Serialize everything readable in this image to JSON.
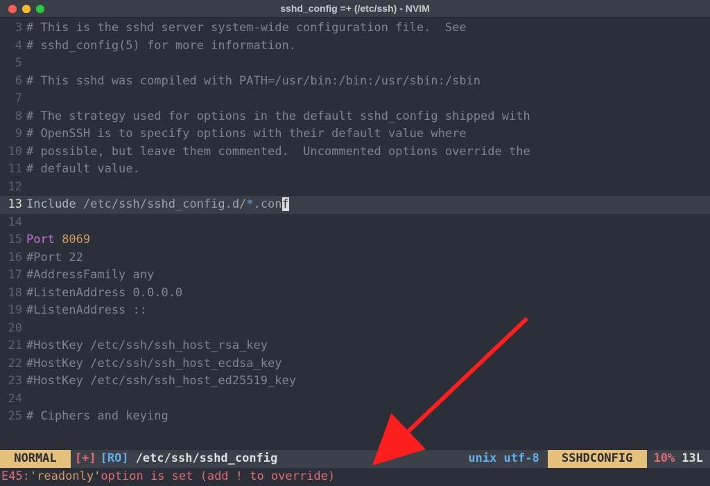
{
  "window": {
    "title": "sshd_config =+ (/etc/ssh) - NVIM"
  },
  "cursor_line_number": "13",
  "lines": {
    "l3": {
      "num": "3",
      "text": "# This is the sshd server system-wide configuration file.  See"
    },
    "l4": {
      "num": "4",
      "text": "# sshd_config(5) for more information."
    },
    "l5": {
      "num": "5",
      "text": ""
    },
    "l6": {
      "num": "6",
      "text": "# This sshd was compiled with PATH=/usr/bin:/bin:/usr/sbin:/sbin"
    },
    "l7": {
      "num": "7",
      "text": ""
    },
    "l8": {
      "num": "8",
      "text": "# The strategy used for options in the default sshd_config shipped with"
    },
    "l9": {
      "num": "9",
      "text": "# OpenSSH is to specify options with their default value where"
    },
    "l10": {
      "num": "10",
      "text": "# possible, but leave them commented.  Uncommented options override the"
    },
    "l11": {
      "num": "11",
      "text": "# default value."
    },
    "l12": {
      "num": "12",
      "text": ""
    },
    "l13": {
      "num": "13",
      "include": "Include ",
      "path": "/etc/ssh/sshd_config.d/",
      "glob": "*",
      "ext": ".con",
      "cursor": "f"
    },
    "l14": {
      "num": "14",
      "text": ""
    },
    "l15": {
      "num": "15",
      "kw": "Port ",
      "val": "8069"
    },
    "l16": {
      "num": "16",
      "text": "#Port 22"
    },
    "l17": {
      "num": "17",
      "text": "#AddressFamily any"
    },
    "l18": {
      "num": "18",
      "text": "#ListenAddress 0.0.0.0"
    },
    "l19": {
      "num": "19",
      "text": "#ListenAddress ::"
    },
    "l20": {
      "num": "20",
      "text": ""
    },
    "l21": {
      "num": "21",
      "text": "#HostKey /etc/ssh/ssh_host_rsa_key"
    },
    "l22": {
      "num": "22",
      "text": "#HostKey /etc/ssh/ssh_host_ecdsa_key"
    },
    "l23": {
      "num": "23",
      "text": "#HostKey /etc/ssh/ssh_host_ed25519_key"
    },
    "l24": {
      "num": "24",
      "text": ""
    },
    "l25": {
      "num": "25",
      "text": "# Ciphers and keying"
    }
  },
  "status": {
    "mode": " NORMAL ",
    "modified": "[+]",
    "readonly": "[RO]",
    "file": "/etc/ssh/sshd_config",
    "encoding": "unix utf-8",
    "filetype": " SSHDCONFIG ",
    "percent": "10%",
    "lines": "13L"
  },
  "cmdline": {
    "prefix": "E45: ",
    "str1": "'readonly'",
    "mid": " option is set (add ! to override)"
  },
  "colors": {
    "bg": "#2b3038",
    "error": "#e06c75",
    "accent": "#e5c07b",
    "blue": "#61afef",
    "purple": "#c678dd",
    "orange": "#d19a66"
  }
}
